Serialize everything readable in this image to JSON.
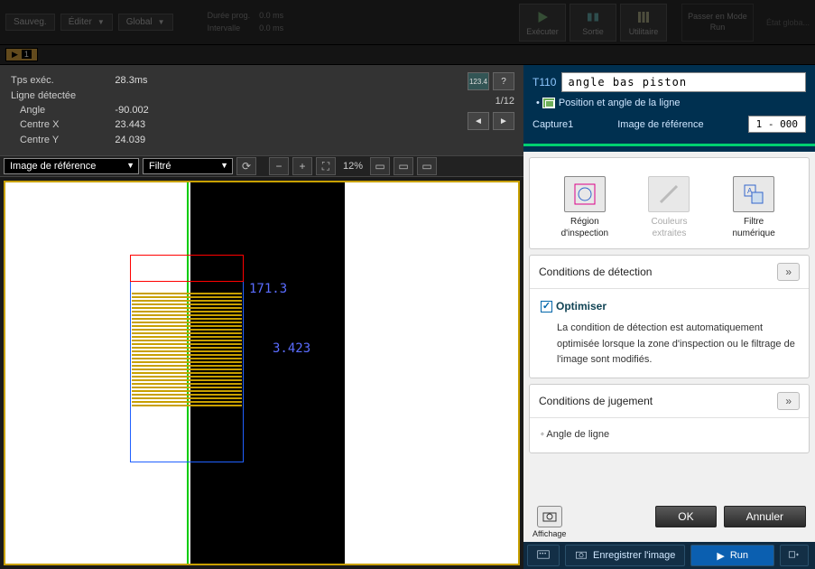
{
  "topbar": {
    "save": "Sauveg.",
    "edit": "Éditer",
    "global": "Global",
    "duree": "Durée prog.",
    "intervalle": "Intervalle",
    "duree_val": "0.0 ms",
    "intervalle_val": "0.0 ms",
    "exec": "Exécuter",
    "sortie": "Sortie",
    "util": "Utilitaire",
    "runmode": "Passer en Mode Run",
    "globstate": "État globa..."
  },
  "badge": {
    "label": "",
    "num": "1"
  },
  "meas": {
    "tps_lbl": "Tps exéc.",
    "tps_val": "28.3ms",
    "ligne_lbl": "Ligne détectée",
    "angle_lbl": "Angle",
    "angle_val": "-90.002",
    "cx_lbl": "Centre X",
    "cx_val": "23.443",
    "cy_lbl": "Centre Y",
    "cy_val": "24.039",
    "counter": "1/12"
  },
  "imgbar": {
    "ref": "Image de référence",
    "filter": "Filtré",
    "zoom": "12%"
  },
  "viewport": {
    "txt1": "171.3",
    "txt2": "3.423"
  },
  "right": {
    "code": "T110",
    "name": "angle bas piston",
    "subtitle": "Position et angle de la ligne",
    "capture": "Capture1",
    "ref_lbl": "Image de référence",
    "ref_val": "1 - 000",
    "cards": {
      "inspect": "Région d'inspection",
      "colors": "Couleurs extraites",
      "filter": "Filtre numérique"
    },
    "sec1_title": "Conditions de détection",
    "sec1_check": "Optimiser",
    "sec1_text": "La condition de détection est automatiquement optimisée lorsque la zone d'inspection ou le filtrage de l'image sont modifiés.",
    "sec2_title": "Conditions de jugement",
    "sec2_item": "Angle de ligne",
    "aff": "Affichage",
    "ok": "OK",
    "cancel": "Annuler",
    "save_img": "Enregistrer l'image",
    "run": "Run"
  }
}
